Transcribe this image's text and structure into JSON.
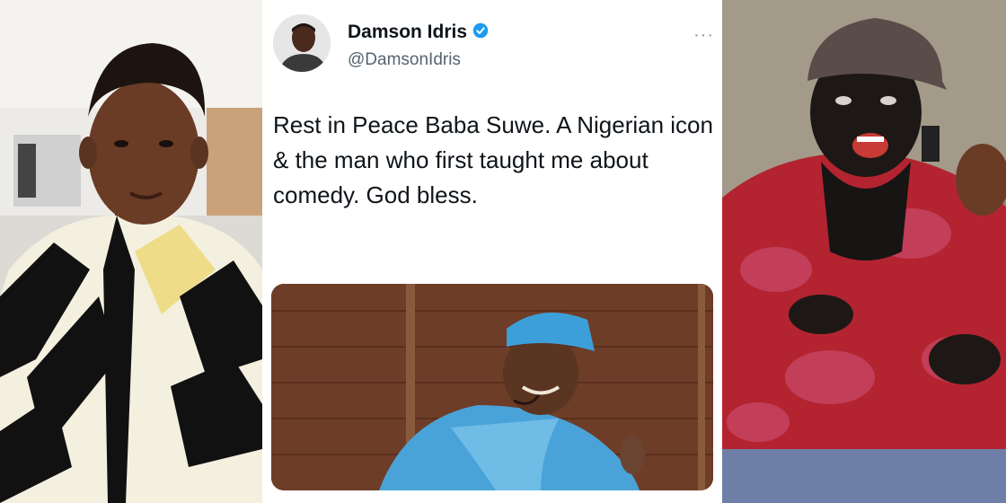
{
  "tweet": {
    "display_name": "Damson Idris",
    "handle": "@DamsonIdris",
    "text": "Rest in Peace Baba Suwe. A Nigerian icon & the man who first taught me about comedy. God bless.",
    "more_label": "···"
  },
  "icons": {
    "verified": "verified-badge-icon",
    "more": "more-options-icon"
  },
  "colors": {
    "verified_blue": "#1d9bf0",
    "text_primary": "#0f1419",
    "text_secondary": "#536471"
  }
}
